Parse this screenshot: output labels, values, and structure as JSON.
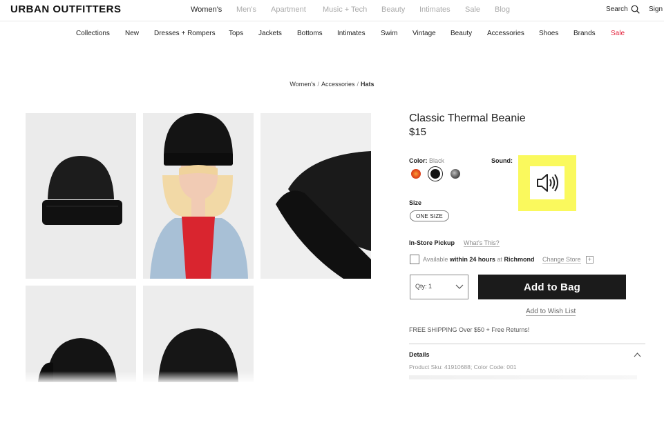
{
  "header": {
    "logo": "URBAN OUTFITTERS",
    "nav": [
      "Women's",
      "Men's",
      "Apartment",
      "Music + Tech",
      "Beauty",
      "Intimates",
      "Sale",
      "Blog"
    ],
    "search_label": "Search",
    "signin_label": "Sign"
  },
  "category_nav": [
    "Collections",
    "New",
    "Dresses + Rompers",
    "Tops",
    "Jackets",
    "Bottoms",
    "Intimates",
    "Swim",
    "Vintage",
    "Beauty",
    "Accessories",
    "Shoes",
    "Brands",
    "Sale"
  ],
  "breadcrumb": {
    "level1": "Women's",
    "level2": "Accessories",
    "current": "Hats",
    "separator": "/"
  },
  "product": {
    "title": "Classic Thermal Beanie",
    "price": "$15",
    "color_label": "Color:",
    "color_value": "Black",
    "swatches": [
      {
        "name": "red-orange",
        "color": "#e8561e"
      },
      {
        "name": "black",
        "color": "#141414"
      },
      {
        "name": "heather-grey",
        "color": "#5a5a5a"
      }
    ],
    "sound_label": "Sound:",
    "size_label": "Size",
    "size_option": "ONE SIZE",
    "pickup_label": "In-Store Pickup",
    "whats_this": "What's This?",
    "availability_prefix": "Available",
    "availability_time": "within 24 hours",
    "availability_at": "at",
    "store_name": "Richmond",
    "change_store": "Change Store",
    "qty_label": "Qty: 1",
    "add_to_bag": "Add to Bag",
    "wishlist": "Add to Wish List",
    "shipping": "FREE SHIPPING Over $50 + Free Returns!",
    "details_label": "Details",
    "sku_line": "Product Sku: 41910688; Color Code: 001"
  },
  "colors": {
    "sale_red": "#e3203a",
    "highlight_yellow": "#faf95d",
    "button_black": "#1b1b1b"
  }
}
